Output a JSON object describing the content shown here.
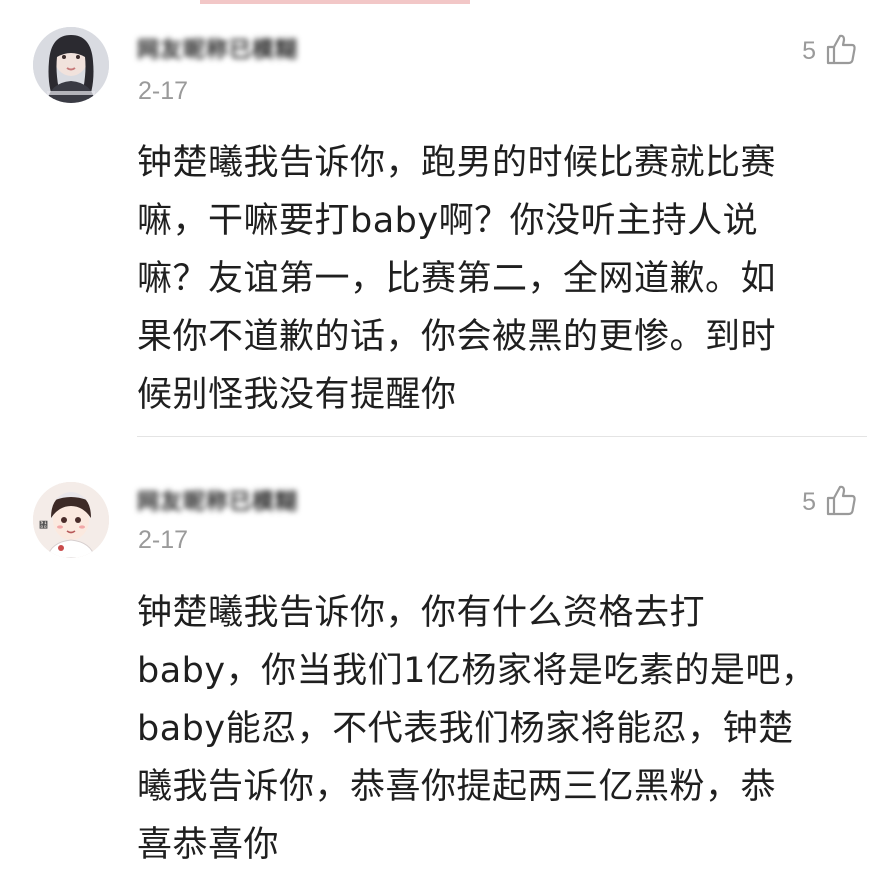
{
  "comments": [
    {
      "username": "网友昵称已模糊",
      "timestamp": "2-17",
      "likes": "5",
      "text": "钟楚曦我告诉你，跑男的时候比赛就比赛\n嘛，干嘛要打baby啊？你没听主持人说\n嘛？友谊第一，比赛第二，全网道歉。如\n果你不道歉的话，你会被黑的更惨。到时\n候别怪我没有提醒你"
    },
    {
      "username": "网友昵称已模糊",
      "timestamp": "2-17",
      "likes": "5",
      "text": "钟楚曦我告诉你，你有什么资格去打\nbaby，你当我们1亿杨家将是吃素的是吧，\nbaby能忍，不代表我们杨家将能忍，钟楚\n曦我告诉你，恭喜你提起两三亿黑粉，恭\n喜恭喜你"
    }
  ],
  "icons": {
    "like": "thumbs-up-icon",
    "avatar": "avatar"
  },
  "colors": {
    "meta_text": "#9a9a9a",
    "body_text": "#1f1f1f",
    "divider": "#e4e4e4"
  }
}
